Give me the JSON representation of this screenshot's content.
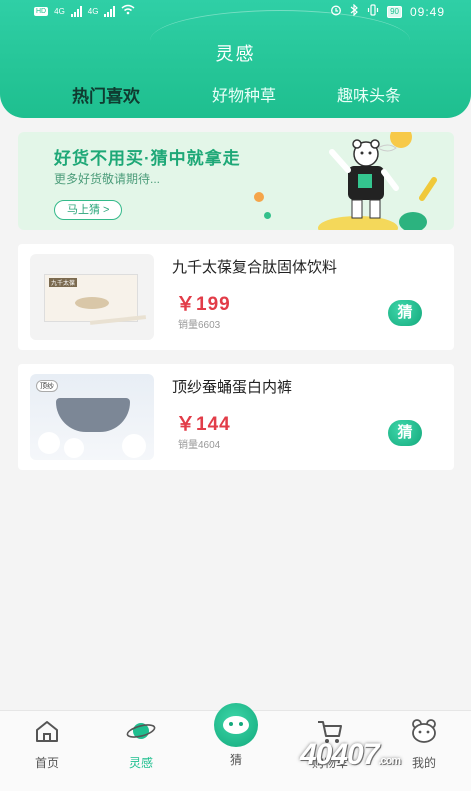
{
  "status": {
    "left_tags": [
      "HD",
      "HD"
    ],
    "network_labels": [
      "4G",
      "4G"
    ],
    "battery": "90",
    "time": "09:49"
  },
  "header": {
    "title": "灵感",
    "tabs": [
      {
        "label": "热门喜欢",
        "active": true
      },
      {
        "label": "好物种草",
        "active": false
      },
      {
        "label": "趣味头条",
        "active": false
      }
    ]
  },
  "banner": {
    "title": "好货不用买·猜中就拿走",
    "subtitle": "更多好货敬请期待...",
    "button": "马上猜 >"
  },
  "products": [
    {
      "name": "九千太葆复合肽固体饮料",
      "price": "￥199",
      "sales": "销量6603",
      "action": "猜",
      "thumb_brand": "九千太葆"
    },
    {
      "name": "顶纱蚕蛹蛋白内裤",
      "price": "￥144",
      "sales": "销量4604",
      "action": "猜",
      "thumb_brand": "顶纱"
    }
  ],
  "tabbar": {
    "items": [
      {
        "label": "首页",
        "icon": "home-icon"
      },
      {
        "label": "灵感",
        "icon": "planet-icon",
        "active": true
      },
      {
        "label": "猜",
        "icon": "guess-face-icon"
      },
      {
        "label": "购物车",
        "icon": "cart-icon"
      },
      {
        "label": "我的",
        "icon": "bear-profile-icon"
      }
    ]
  },
  "watermark": {
    "text": "40407",
    "suffix": ".com"
  },
  "colors": {
    "accent": "#1ebf8f",
    "price": "#e23c48",
    "banner_bg": "#e3f6e8"
  }
}
